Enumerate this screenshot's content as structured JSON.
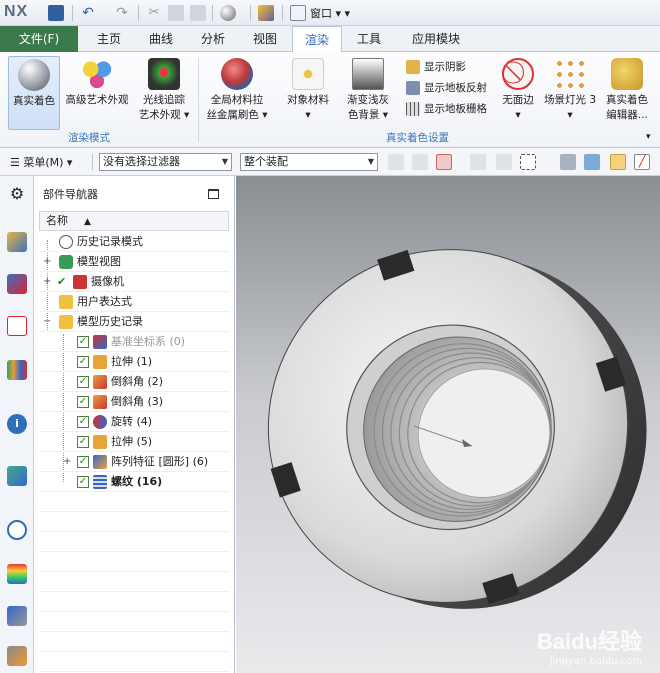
{
  "app": {
    "logo": "NX",
    "window_menu": "窗口"
  },
  "tabs": [
    {
      "id": "file",
      "label": "文件(F)"
    },
    {
      "id": "home",
      "label": "主页"
    },
    {
      "id": "curve",
      "label": "曲线"
    },
    {
      "id": "analysis",
      "label": "分析"
    },
    {
      "id": "view",
      "label": "视图"
    },
    {
      "id": "render",
      "label": "渲染"
    },
    {
      "id": "tools",
      "label": "工具"
    },
    {
      "id": "apps",
      "label": "应用模块"
    }
  ],
  "ribbon": {
    "render_mode": {
      "group_label": "渲染模式",
      "buttons": [
        {
          "label": "真实着色"
        },
        {
          "label": "高级艺术外观"
        },
        {
          "label": "光线追踪",
          "label2": "艺术外观"
        }
      ]
    },
    "true_shading": {
      "group_label": "真实着色设置",
      "buttons": [
        {
          "label": "全局材料拉",
          "label2": "丝金属刷色"
        },
        {
          "label": "对象材料"
        },
        {
          "label": "渐变浅灰",
          "label2": "色背景"
        },
        {
          "label": "无面边"
        },
        {
          "label": "场景灯光 3"
        },
        {
          "label": "真实着色",
          "label2": "编辑器..."
        }
      ],
      "small_buttons": [
        {
          "label": "显示阴影"
        },
        {
          "label": "显示地板反射"
        },
        {
          "label": "显示地板栅格"
        }
      ]
    }
  },
  "toolbar": {
    "menu_label": "菜单(M)",
    "filter_value": "没有选择过滤器",
    "assembly_value": "整个装配"
  },
  "navigator": {
    "title": "部件导航器",
    "column_name": "名称",
    "rows": [
      {
        "label": "历史记录模式",
        "icon": "clock-icon"
      },
      {
        "label": "模型视图",
        "icon": "views-icon"
      },
      {
        "label": "摄像机",
        "icon": "camera-icon"
      },
      {
        "label": "用户表达式",
        "icon": "folder-icon"
      },
      {
        "label": "模型历史记录",
        "icon": "folder-open-icon"
      },
      {
        "label": "基准坐标系 (0)",
        "icon": "datum-csys-icon"
      },
      {
        "label": "拉伸 (1)",
        "icon": "extrude-icon"
      },
      {
        "label": "倒斜角 (2)",
        "icon": "chamfer-icon"
      },
      {
        "label": "倒斜角 (3)",
        "icon": "chamfer-icon"
      },
      {
        "label": "旋转 (4)",
        "icon": "revolve-icon"
      },
      {
        "label": "拉伸 (5)",
        "icon": "extrude-icon"
      },
      {
        "label": "阵列特征 [圆形] (6)",
        "icon": "pattern-icon"
      },
      {
        "label": "螺纹 (16)",
        "icon": "thread-icon"
      }
    ]
  },
  "watermark": {
    "brand": "Baidu经验",
    "url": "jingyan.baidu.com"
  },
  "colors": {
    "file_tab": "#3b7a4a",
    "accent": "#2a6cc7",
    "group_label": "#3b76b8"
  }
}
